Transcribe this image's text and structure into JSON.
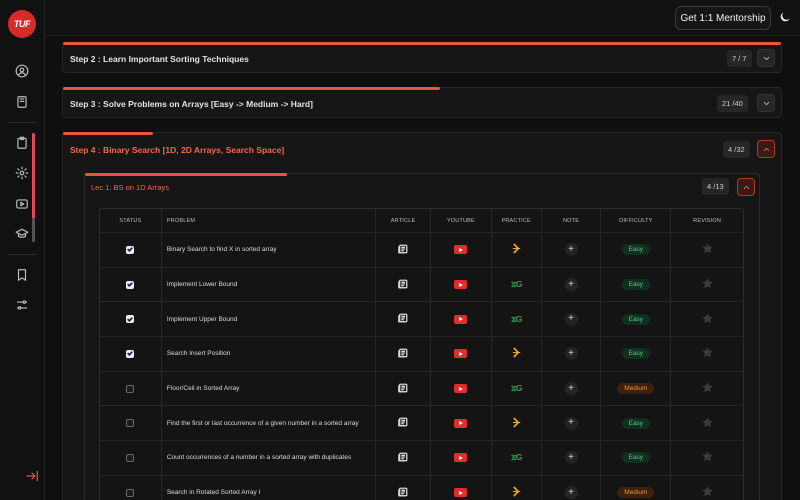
{
  "app": {
    "logo_text": "TUF"
  },
  "header": {
    "mentorship_label": "Get 1:1 Mentorship"
  },
  "sidebar": {
    "icons": [
      "user-circle-icon",
      "notebook-icon",
      "clipboard-icon",
      "gear-icon",
      "video-icon",
      "graduation-cap-icon",
      "bookmark-icon",
      "sliders-icon",
      "logout-icon"
    ]
  },
  "steps": [
    {
      "title": "Step 2 : Learn Important Sorting Techniques",
      "count": "7 / 7",
      "progress": 1.0
    },
    {
      "title": "Step 3 : Solve Problems on Arrays [Easy -> Medium -> Hard]",
      "count": "21 /40",
      "progress": 0.525
    },
    {
      "title": "Step 4 : Binary Search [1D, 2D Arrays, Search Space]",
      "count": "4 /32",
      "progress": 0.125
    }
  ],
  "lecture": {
    "title": "Lec 1: BS on 1D Arrays",
    "count": "4 /13",
    "progress": 0.31
  },
  "table": {
    "headers": {
      "status": "STATUS",
      "problem": "PROBLEM",
      "article": "ARTICLE",
      "youtube": "YOUTUBE",
      "practice": "PRACTICE",
      "note": "NOTE",
      "difficulty": "DIFFICULTY",
      "revision": "REVISION"
    },
    "rows": [
      {
        "done": true,
        "problem": "Binary Search to find X in sorted array",
        "practice": "codingninjas",
        "difficulty": "Easy"
      },
      {
        "done": true,
        "problem": "Implement Lower Bound",
        "practice": "gfg",
        "difficulty": "Easy"
      },
      {
        "done": true,
        "problem": "Implement Upper Bound",
        "practice": "gfg",
        "difficulty": "Easy"
      },
      {
        "done": true,
        "problem": "Search Insert Position",
        "practice": "codingninjas",
        "difficulty": "Easy"
      },
      {
        "done": false,
        "problem": "Floor/Ceil in Sorted Array",
        "practice": "gfg",
        "difficulty": "Medium"
      },
      {
        "done": false,
        "problem": "Find the first or last occurrence of a given number in a sorted array",
        "practice": "codingninjas",
        "difficulty": "Easy"
      },
      {
        "done": false,
        "problem": "Count occurrences of a number in a sorted array with duplicates",
        "practice": "gfg",
        "difficulty": "Easy"
      },
      {
        "done": false,
        "problem": "Search in Rotated Sorted Array I",
        "practice": "codingninjas",
        "difficulty": "Medium"
      }
    ]
  },
  "colors": {
    "accent": "#e6563a",
    "easy": "#5fc98a",
    "medium": "#e8953a",
    "youtube": "#e52b2b"
  }
}
